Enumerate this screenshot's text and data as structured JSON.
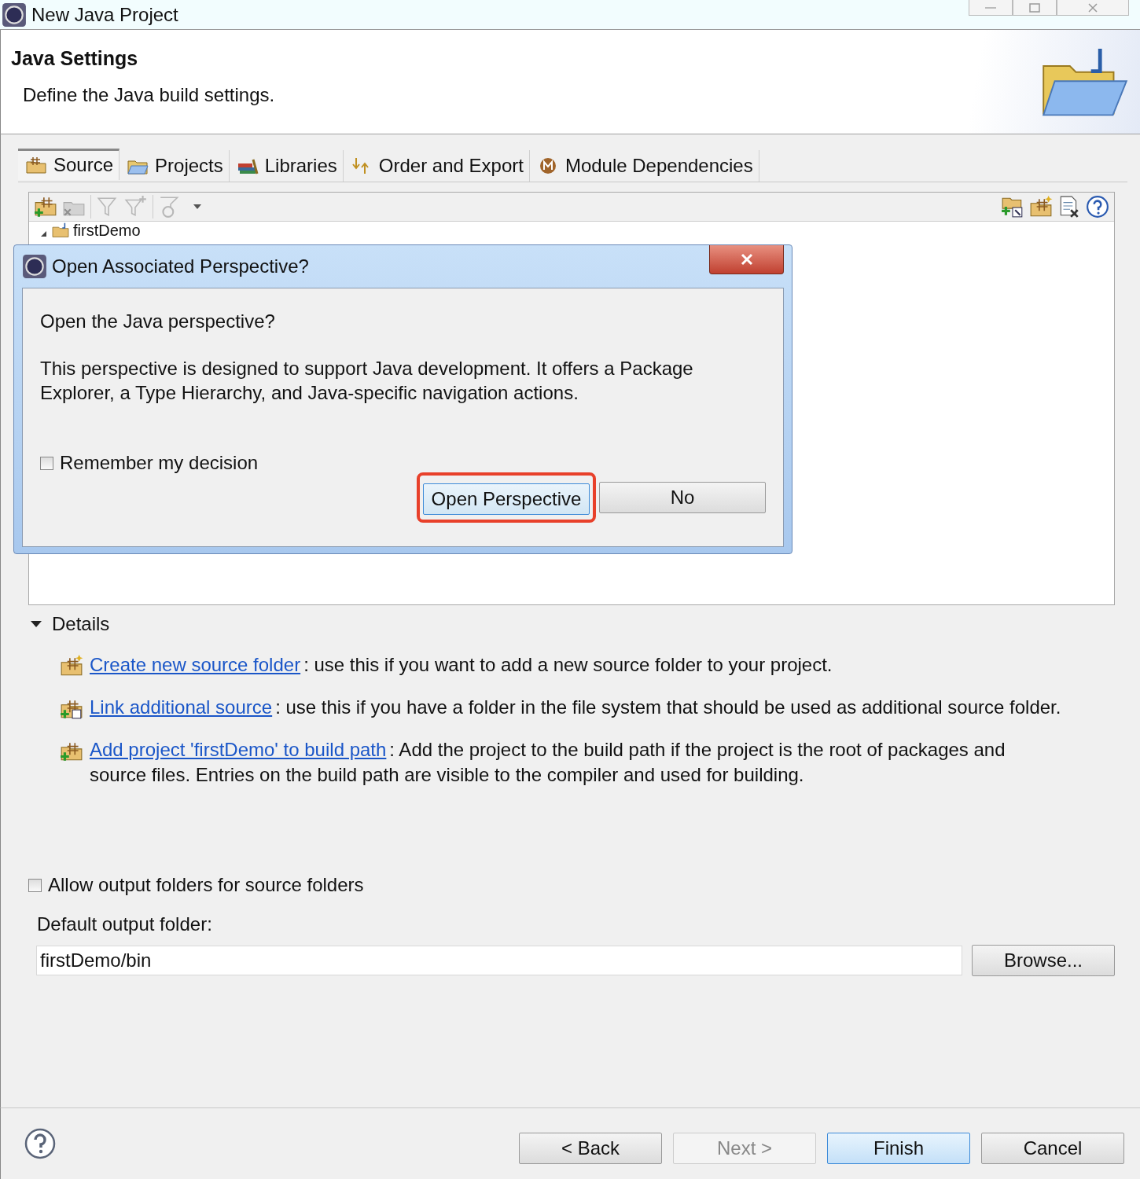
{
  "window": {
    "title": "New Java Project"
  },
  "header": {
    "title": "Java Settings",
    "subtitle": "Define the Java build settings."
  },
  "tabs": [
    {
      "label": "Source",
      "selected": true
    },
    {
      "label": "Projects",
      "selected": false
    },
    {
      "label": "Libraries",
      "selected": false
    },
    {
      "label": "Order and Export",
      "selected": false
    },
    {
      "label": "Module Dependencies",
      "selected": false
    }
  ],
  "tree": [
    {
      "label": "firstDemo"
    }
  ],
  "details": {
    "label": "Details",
    "expanded": true,
    "items": [
      {
        "link": "Create new source folder",
        "text": ": use this if you want to add a new source folder to your project."
      },
      {
        "link": "Link additional source",
        "text": ": use this if you have a folder in the file system that should be used as additional source folder."
      },
      {
        "link": "Add project 'firstDemo' to build path",
        "text": ": Add the project to the build path if the project is the root of packages and source files. Entries on the build path are visible to the compiler and used for building."
      }
    ]
  },
  "allow_output": {
    "label": "Allow output folders for source folders",
    "checked": false
  },
  "default_output": {
    "label": "Default output folder:",
    "value": "firstDemo/bin"
  },
  "browse_button": "Browse...",
  "footer_buttons": [
    {
      "label": "< Back",
      "disabled": false,
      "default": false
    },
    {
      "label": "Next >",
      "disabled": true,
      "default": false
    },
    {
      "label": "Finish",
      "disabled": false,
      "default": true
    },
    {
      "label": "Cancel",
      "disabled": false,
      "default": false
    }
  ],
  "dialog": {
    "title": "Open Associated Perspective?",
    "question": "Open the Java perspective?",
    "description": "This perspective is designed to support Java development. It offers a Package Explorer, a Type Hierarchy, and Java-specific navigation actions.",
    "remember": {
      "label": "Remember my decision",
      "checked": false
    },
    "buttons": [
      {
        "label": "Open Perspective",
        "default": true,
        "highlighted": true
      },
      {
        "label": "No",
        "default": false,
        "highlighted": false
      }
    ]
  }
}
